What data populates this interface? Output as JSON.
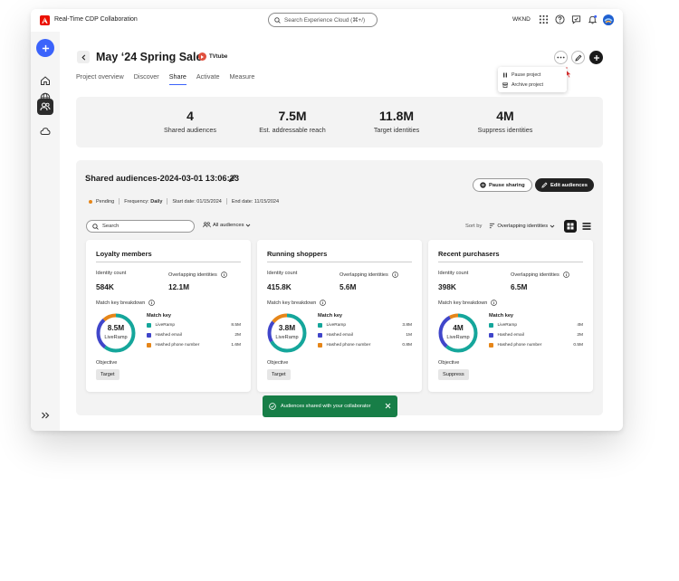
{
  "app": {
    "title": "Real-Time CDP Collaboration",
    "search_placeholder": "Search Experience Cloud (⌘+/)",
    "org": "WKND"
  },
  "project": {
    "title": "May ‘24 Spring Sale",
    "brand": "TVtube"
  },
  "tabs": [
    {
      "label": "Project overview",
      "active": false
    },
    {
      "label": "Discover",
      "active": false
    },
    {
      "label": "Share",
      "active": true
    },
    {
      "label": "Activate",
      "active": false
    },
    {
      "label": "Measure",
      "active": false
    }
  ],
  "more_menu": {
    "items": [
      {
        "label": "Pause project",
        "icon": "pause-icon"
      },
      {
        "label": "Archive project",
        "icon": "archive-icon"
      }
    ]
  },
  "stats": [
    {
      "value": "4",
      "label": "Shared audiences"
    },
    {
      "value": "7.5M",
      "label": "Est. addressable reach"
    },
    {
      "value": "11.8M",
      "label": "Target identities"
    },
    {
      "value": "4M",
      "label": "Suppress identities"
    }
  ],
  "shared": {
    "title": "Shared audiences-2024-03-01 13:06:23",
    "status": "Pending",
    "frequency_label": "Frequency:",
    "frequency": "Daily",
    "start_date": "Start date: 01/15/2024",
    "end_date": "End date: 11/15/2024",
    "pause_label": "Pause sharing",
    "edit_label": "Edit audiences",
    "search_placeholder": "Search",
    "filter_label": "All audiences",
    "sort_label": "Sort by",
    "sort_value": "Overlapping identities"
  },
  "card_labels": {
    "identity_count": "Identity count",
    "overlapping": "Overlapping identities",
    "breakdown": "Match key breakdown",
    "match_key": "Match key",
    "objective": "Objective",
    "donut_sub": "LiveRamp"
  },
  "cards": [
    {
      "title": "Loyalty members",
      "identity_count": "584K",
      "overlapping": "12.1M",
      "donut_value": "8.5M",
      "keys": [
        {
          "name": "LiveRamp",
          "value": "8.5M",
          "color": "#15a69b"
        },
        {
          "name": "Hashed email",
          "value": "2M",
          "color": "#4046ca"
        },
        {
          "name": "Hashed phone number",
          "value": "1.6M",
          "color": "#e68619"
        }
      ],
      "objective": "Target"
    },
    {
      "title": "Running shoppers",
      "identity_count": "415.8K",
      "overlapping": "5.6M",
      "donut_value": "3.8M",
      "keys": [
        {
          "name": "LiveRamp",
          "value": "3.8M",
          "color": "#15a69b"
        },
        {
          "name": "Hashed email",
          "value": "1M",
          "color": "#4046ca"
        },
        {
          "name": "Hashed phone number",
          "value": "0.8M",
          "color": "#e68619"
        }
      ],
      "objective": "Target"
    },
    {
      "title": "Recent purchasers",
      "identity_count": "398K",
      "overlapping": "6.5M",
      "donut_value": "4M",
      "keys": [
        {
          "name": "LiveRamp",
          "value": "4M",
          "color": "#15a69b"
        },
        {
          "name": "Hashed email",
          "value": "2M",
          "color": "#4046ca"
        },
        {
          "name": "Hashed phone number",
          "value": "0.5M",
          "color": "#e68619"
        }
      ],
      "objective": "Suppress"
    }
  ],
  "toast": {
    "message": "Audiences shared with your collaborator"
  },
  "colors": {
    "accent": "#3b63fb",
    "success": "#177e47",
    "pending": "#e68619"
  }
}
